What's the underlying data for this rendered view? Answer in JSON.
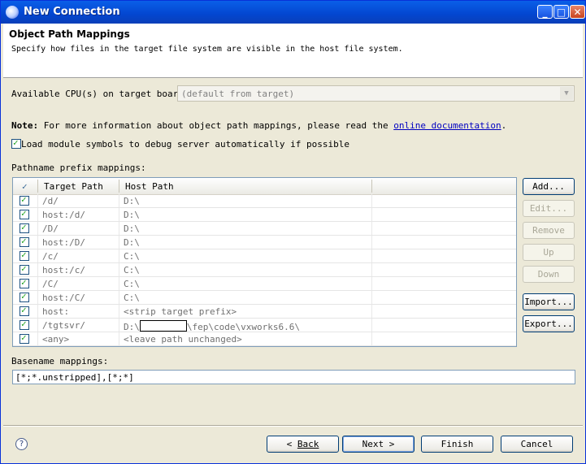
{
  "window": {
    "title": "New Connection",
    "controls": {
      "minimize": "_",
      "maximize": "□",
      "close": "✕"
    }
  },
  "header": {
    "title": "Object Path Mappings",
    "description": "Specify how files in the target file system are visible in the host file system."
  },
  "cpu": {
    "label": "Available CPU(s) on target board:",
    "value": "(default from target)"
  },
  "note": {
    "bold": "Note:",
    "text": " For more information about object path mappings, please read the ",
    "link": "online documentation",
    "end": "."
  },
  "load_symbols": {
    "label": "Load module symbols to debug server automatically if possible",
    "checked": true
  },
  "pathname": {
    "label": "Pathname prefix mappings:",
    "columns": {
      "check": "✓",
      "target": "Target Path",
      "host": "Host Path"
    },
    "rows": [
      {
        "target": "/d/",
        "host": "D:\\"
      },
      {
        "target": "host:/d/",
        "host": "D:\\"
      },
      {
        "target": "/D/",
        "host": "D:\\"
      },
      {
        "target": "host:/D/",
        "host": "D:\\"
      },
      {
        "target": "/c/",
        "host": "C:\\"
      },
      {
        "target": "host:/c/",
        "host": "C:\\"
      },
      {
        "target": "/C/",
        "host": "C:\\"
      },
      {
        "target": "host:/C/",
        "host": "C:\\"
      },
      {
        "target": "host:",
        "host": "<strip target prefix>"
      },
      {
        "target": "/tgtsvr/",
        "host_pre": "D:\\",
        "host_post": "\\fep\\code\\vxworks6.6\\"
      },
      {
        "target": "<any>",
        "host": "<leave path unchanged>"
      }
    ]
  },
  "side_buttons": {
    "add": "Add...",
    "edit": "Edit...",
    "remove": "Remove",
    "up": "Up",
    "down": "Down",
    "import": "Import...",
    "export": "Export..."
  },
  "basename": {
    "label": "Basename mappings:",
    "value": "[*;*.unstripped],[*;*]"
  },
  "footer": {
    "help": "?",
    "back": "Back",
    "next": "Next >",
    "finish": "Finish",
    "cancel": "Cancel"
  }
}
